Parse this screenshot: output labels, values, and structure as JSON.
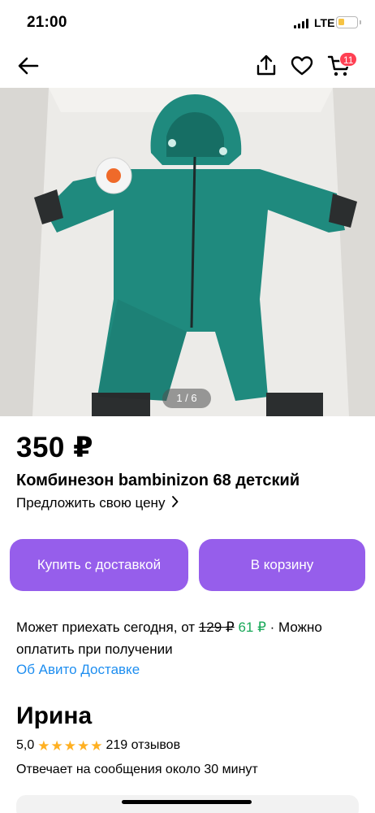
{
  "status_bar": {
    "time": "21:00",
    "network": "LTE"
  },
  "nav": {
    "cart_count": "11",
    "icons": [
      "back-arrow-icon",
      "share-icon",
      "heart-icon",
      "cart-icon"
    ]
  },
  "gallery": {
    "counter": "1 / 6"
  },
  "product": {
    "price": "350 ₽",
    "title": "Комбинезон bambinizon 68 детский",
    "offer_price_label": "Предложить свою цену"
  },
  "actions": {
    "buy_delivery_label": "Купить с доставкой",
    "add_to_cart_label": "В корзину"
  },
  "delivery": {
    "text_before": "Может приехать сегодня, от ",
    "old_price": "129 ₽",
    "new_price": "61 ₽",
    "text_after": " · Можно оплатить при получении",
    "link": "Об Авито Доставке"
  },
  "seller": {
    "name": "Ирина",
    "rating": "5,0",
    "stars": 5,
    "reviews": "219 отзывов",
    "response_time": "Отвечает на сообщения около 30 минут"
  },
  "colors": {
    "accent": "#965eeb",
    "link": "#1e8ef0",
    "green": "#18a858",
    "star": "#ffb021",
    "badge": "#ff4053",
    "product": "#1f8a7e"
  }
}
